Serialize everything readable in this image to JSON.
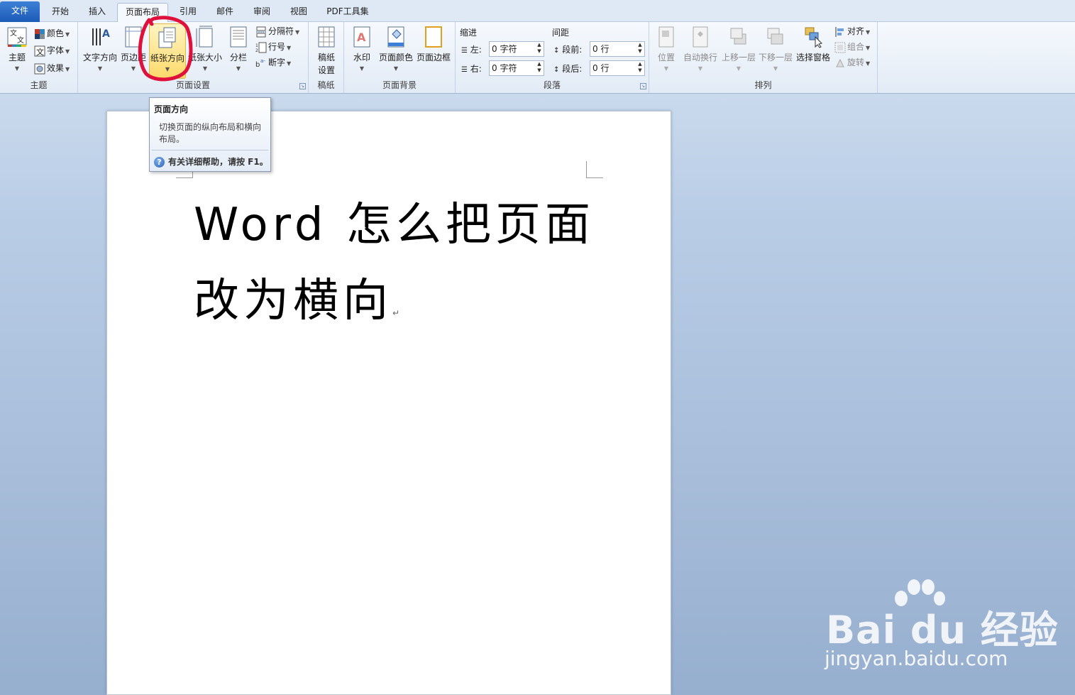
{
  "tabs": [
    {
      "label": "文件"
    },
    {
      "label": "开始"
    },
    {
      "label": "插入"
    },
    {
      "label": "页面布局"
    },
    {
      "label": "引用"
    },
    {
      "label": "邮件"
    },
    {
      "label": "审阅"
    },
    {
      "label": "视图"
    },
    {
      "label": "PDF工具集"
    }
  ],
  "active_tab": "页面布局",
  "ribbon": {
    "theme": {
      "label": "主题",
      "big_button": "主题",
      "colors": "颜色",
      "fonts": "字体",
      "effects": "效果"
    },
    "page_setup": {
      "label": "页面设置",
      "text_direction": "文字方向",
      "margins": "页边距",
      "orientation": "纸张方向",
      "size": "纸张大小",
      "columns": "分栏",
      "breaks": "分隔符",
      "line_numbers": "行号",
      "hyphenation": "断字"
    },
    "manuscript": {
      "label": "稿纸",
      "button_line1": "稿纸",
      "button_line2": "设置"
    },
    "page_background": {
      "label": "页面背景",
      "watermark": "水印",
      "page_color": "页面颜色",
      "page_borders": "页面边框"
    },
    "paragraph": {
      "label": "段落",
      "indent_title": "缩进",
      "spacing_title": "间距",
      "indent_left_label": "左:",
      "indent_left_value": "0 字符",
      "indent_right_label": "右:",
      "indent_right_value": "0 字符",
      "spacing_before_label": "段前:",
      "spacing_before_value": "0 行",
      "spacing_after_label": "段后:",
      "spacing_after_value": "0 行"
    },
    "arrange": {
      "label": "排列",
      "position": "位置",
      "wrap_text": "自动换行",
      "bring_forward": "上移一层",
      "send_backward": "下移一层",
      "selection_pane": "选择窗格",
      "align": "对齐",
      "group": "组合",
      "rotate": "旋转"
    }
  },
  "tooltip": {
    "title": "页面方向",
    "body": "切换页面的纵向布局和横向布局。",
    "help": "有关详细帮助，请按 F1。",
    "help_icon": "?"
  },
  "document": {
    "line1": "Word 怎么把页面",
    "line2": "改为横向",
    "paragraph_mark": "↵"
  },
  "watermark": {
    "brand": "Bai du 经验",
    "url": "jingyan.baidu.com"
  },
  "colors": {
    "file_tab": "#2b6cc8",
    "highlight": "#fcd96a",
    "marker": "#e0103c"
  }
}
